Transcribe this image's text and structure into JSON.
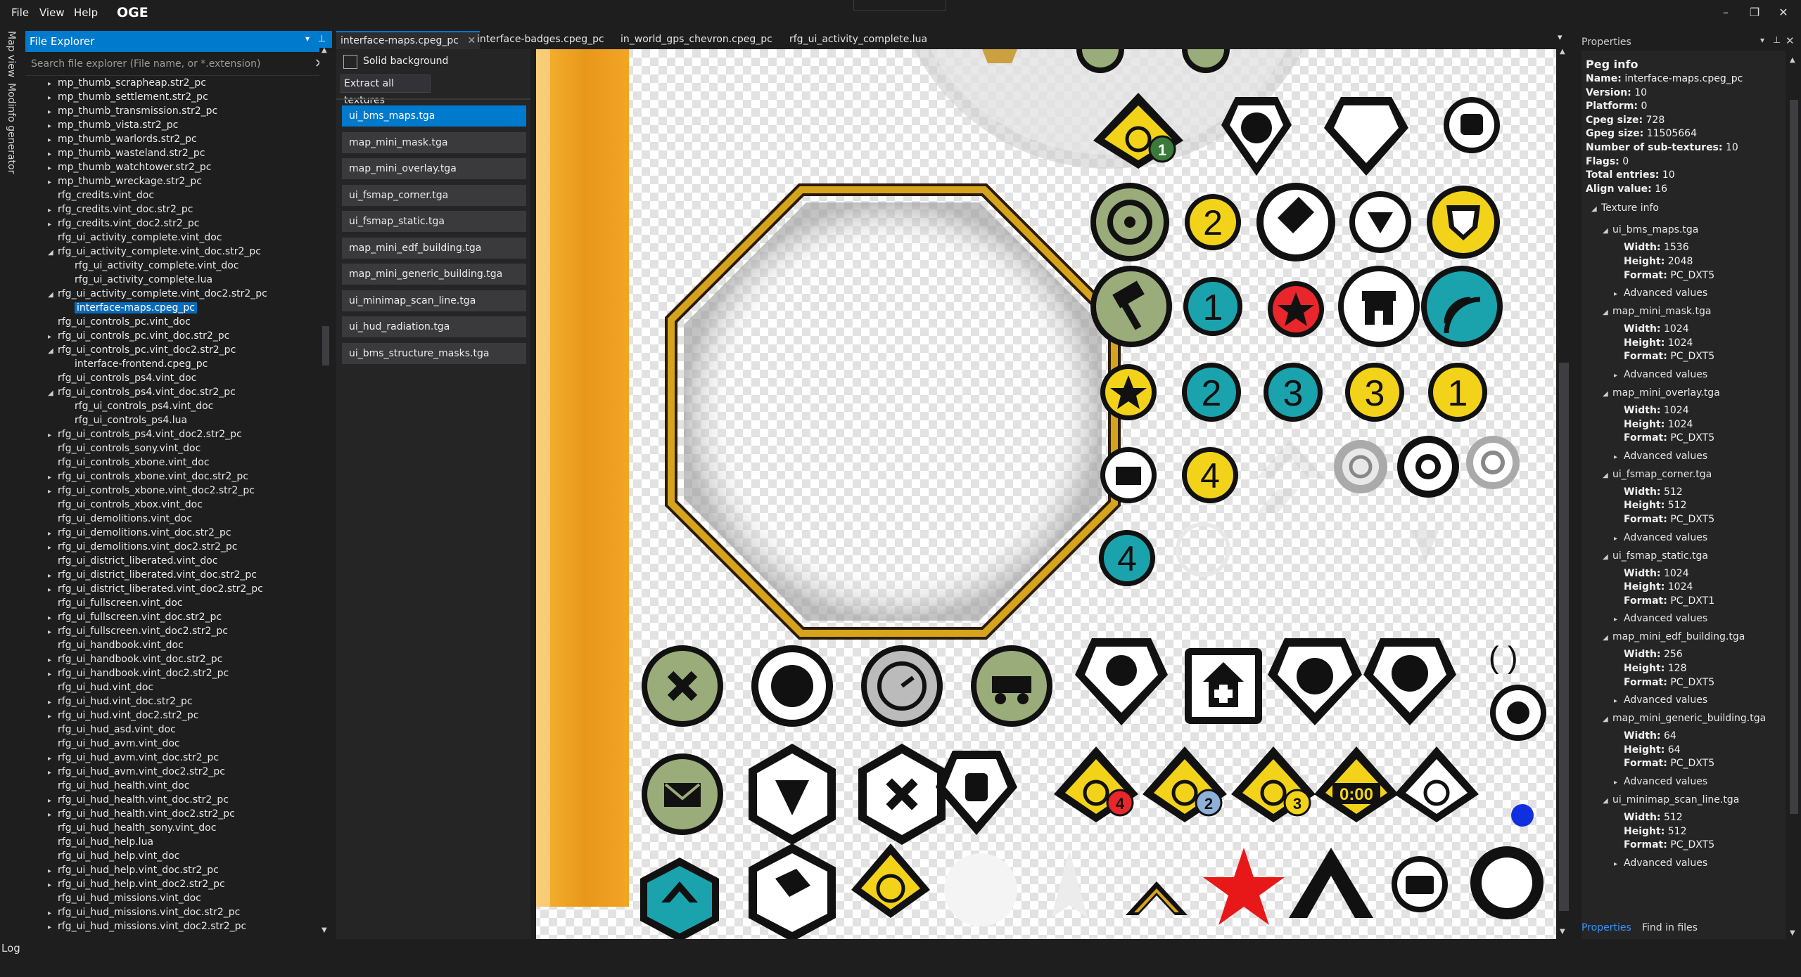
{
  "app": {
    "title": "OGE"
  },
  "menu": {
    "items": [
      "File",
      "View",
      "Help"
    ]
  },
  "window_controls": {
    "minimize": "–",
    "restore": "❐",
    "close": "✕"
  },
  "side_tabs": [
    "Map view",
    "Modinfo generator"
  ],
  "explorer": {
    "title": "File Explorer",
    "search_placeholder": "Search file explorer (File name, or *.extension)",
    "items": [
      {
        "label": "mp_thumb_scrapheap.str2_pc",
        "level": 1,
        "arrow": "▸"
      },
      {
        "label": "mp_thumb_settlement.str2_pc",
        "level": 1,
        "arrow": "▸"
      },
      {
        "label": "mp_thumb_transmission.str2_pc",
        "level": 1,
        "arrow": "▸"
      },
      {
        "label": "mp_thumb_vista.str2_pc",
        "level": 1,
        "arrow": "▸"
      },
      {
        "label": "mp_thumb_warlords.str2_pc",
        "level": 1,
        "arrow": "▸"
      },
      {
        "label": "mp_thumb_wasteland.str2_pc",
        "level": 1,
        "arrow": "▸"
      },
      {
        "label": "mp_thumb_watchtower.str2_pc",
        "level": 1,
        "arrow": "▸"
      },
      {
        "label": "mp_thumb_wreckage.str2_pc",
        "level": 1,
        "arrow": "▸"
      },
      {
        "label": "rfg_credits.vint_doc",
        "level": 1,
        "arrow": ""
      },
      {
        "label": "rfg_credits.vint_doc.str2_pc",
        "level": 1,
        "arrow": "▸"
      },
      {
        "label": "rfg_credits.vint_doc2.str2_pc",
        "level": 1,
        "arrow": "▸"
      },
      {
        "label": "rfg_ui_activity_complete.vint_doc",
        "level": 1,
        "arrow": ""
      },
      {
        "label": "rfg_ui_activity_complete.vint_doc.str2_pc",
        "level": 1,
        "arrow": "◢"
      },
      {
        "label": "rfg_ui_activity_complete.vint_doc",
        "level": 2,
        "arrow": ""
      },
      {
        "label": "rfg_ui_activity_complete.lua",
        "level": 2,
        "arrow": ""
      },
      {
        "label": "rfg_ui_activity_complete.vint_doc2.str2_pc",
        "level": 1,
        "arrow": "◢"
      },
      {
        "label": "interface-maps.cpeg_pc",
        "level": 2,
        "arrow": "",
        "selected": true
      },
      {
        "label": "rfg_ui_controls_pc.vint_doc",
        "level": 1,
        "arrow": ""
      },
      {
        "label": "rfg_ui_controls_pc.vint_doc.str2_pc",
        "level": 1,
        "arrow": "▸"
      },
      {
        "label": "rfg_ui_controls_pc.vint_doc2.str2_pc",
        "level": 1,
        "arrow": "◢"
      },
      {
        "label": "interface-frontend.cpeg_pc",
        "level": 2,
        "arrow": ""
      },
      {
        "label": "rfg_ui_controls_ps4.vint_doc",
        "level": 1,
        "arrow": ""
      },
      {
        "label": "rfg_ui_controls_ps4.vint_doc.str2_pc",
        "level": 1,
        "arrow": "◢"
      },
      {
        "label": "rfg_ui_controls_ps4.vint_doc",
        "level": 2,
        "arrow": ""
      },
      {
        "label": "rfg_ui_controls_ps4.lua",
        "level": 2,
        "arrow": ""
      },
      {
        "label": "rfg_ui_controls_ps4.vint_doc2.str2_pc",
        "level": 1,
        "arrow": "▸"
      },
      {
        "label": "rfg_ui_controls_sony.vint_doc",
        "level": 1,
        "arrow": ""
      },
      {
        "label": "rfg_ui_controls_xbone.vint_doc",
        "level": 1,
        "arrow": ""
      },
      {
        "label": "rfg_ui_controls_xbone.vint_doc.str2_pc",
        "level": 1,
        "arrow": "▸"
      },
      {
        "label": "rfg_ui_controls_xbone.vint_doc2.str2_pc",
        "level": 1,
        "arrow": "▸"
      },
      {
        "label": "rfg_ui_controls_xbox.vint_doc",
        "level": 1,
        "arrow": ""
      },
      {
        "label": "rfg_ui_demolitions.vint_doc",
        "level": 1,
        "arrow": ""
      },
      {
        "label": "rfg_ui_demolitions.vint_doc.str2_pc",
        "level": 1,
        "arrow": "▸"
      },
      {
        "label": "rfg_ui_demolitions.vint_doc2.str2_pc",
        "level": 1,
        "arrow": "▸"
      },
      {
        "label": "rfg_ui_district_liberated.vint_doc",
        "level": 1,
        "arrow": ""
      },
      {
        "label": "rfg_ui_district_liberated.vint_doc.str2_pc",
        "level": 1,
        "arrow": "▸"
      },
      {
        "label": "rfg_ui_district_liberated.vint_doc2.str2_pc",
        "level": 1,
        "arrow": "▸"
      },
      {
        "label": "rfg_ui_fullscreen.vint_doc",
        "level": 1,
        "arrow": ""
      },
      {
        "label": "rfg_ui_fullscreen.vint_doc.str2_pc",
        "level": 1,
        "arrow": "▸"
      },
      {
        "label": "rfg_ui_fullscreen.vint_doc2.str2_pc",
        "level": 1,
        "arrow": "▸"
      },
      {
        "label": "rfg_ui_handbook.vint_doc",
        "level": 1,
        "arrow": ""
      },
      {
        "label": "rfg_ui_handbook.vint_doc.str2_pc",
        "level": 1,
        "arrow": "▸"
      },
      {
        "label": "rfg_ui_handbook.vint_doc2.str2_pc",
        "level": 1,
        "arrow": "▸"
      },
      {
        "label": "rfg_ui_hud.vint_doc",
        "level": 1,
        "arrow": ""
      },
      {
        "label": "rfg_ui_hud.vint_doc.str2_pc",
        "level": 1,
        "arrow": "▸"
      },
      {
        "label": "rfg_ui_hud.vint_doc2.str2_pc",
        "level": 1,
        "arrow": "▸"
      },
      {
        "label": "rfg_ui_hud_asd.vint_doc",
        "level": 1,
        "arrow": ""
      },
      {
        "label": "rfg_ui_hud_avm.vint_doc",
        "level": 1,
        "arrow": ""
      },
      {
        "label": "rfg_ui_hud_avm.vint_doc.str2_pc",
        "level": 1,
        "arrow": "▸"
      },
      {
        "label": "rfg_ui_hud_avm.vint_doc2.str2_pc",
        "level": 1,
        "arrow": "▸"
      },
      {
        "label": "rfg_ui_hud_health.vint_doc",
        "level": 1,
        "arrow": ""
      },
      {
        "label": "rfg_ui_hud_health.vint_doc.str2_pc",
        "level": 1,
        "arrow": "▸"
      },
      {
        "label": "rfg_ui_hud_health.vint_doc2.str2_pc",
        "level": 1,
        "arrow": "▸"
      },
      {
        "label": "rfg_ui_hud_health_sony.vint_doc",
        "level": 1,
        "arrow": ""
      },
      {
        "label": "rfg_ui_hud_help.lua",
        "level": 1,
        "arrow": ""
      },
      {
        "label": "rfg_ui_hud_help.vint_doc",
        "level": 1,
        "arrow": ""
      },
      {
        "label": "rfg_ui_hud_help.vint_doc.str2_pc",
        "level": 1,
        "arrow": "▸"
      },
      {
        "label": "rfg_ui_hud_help.vint_doc2.str2_pc",
        "level": 1,
        "arrow": "▸"
      },
      {
        "label": "rfg_ui_hud_missions.vint_doc",
        "level": 1,
        "arrow": ""
      },
      {
        "label": "rfg_ui_hud_missions.vint_doc.str2_pc",
        "level": 1,
        "arrow": "▸"
      },
      {
        "label": "rfg_ui_hud_missions.vint_doc2.str2_pc",
        "level": 1,
        "arrow": "▸"
      }
    ]
  },
  "tabs": [
    {
      "label": "interface-maps.cpeg_pc",
      "active": true,
      "close": "✕"
    },
    {
      "label": "interface-badges.cpeg_pc"
    },
    {
      "label": "in_world_gps_chevron.cpeg_pc"
    },
    {
      "label": "rfg_ui_activity_complete.lua"
    }
  ],
  "texture_panel": {
    "solid_background_label": "Solid background",
    "extract_all_label": "Extract all textures",
    "textures": [
      {
        "name": "ui_bms_maps.tga",
        "selected": true
      },
      {
        "name": "map_mini_mask.tga"
      },
      {
        "name": "map_mini_overlay.tga"
      },
      {
        "name": "ui_fsmap_corner.tga"
      },
      {
        "name": "ui_fsmap_static.tga"
      },
      {
        "name": "map_mini_edf_building.tga"
      },
      {
        "name": "map_mini_generic_building.tga"
      },
      {
        "name": "ui_minimap_scan_line.tga"
      },
      {
        "name": "ui_hud_radiation.tga"
      },
      {
        "name": "ui_bms_structure_masks.tga"
      }
    ]
  },
  "preview": {
    "badge_numbers": {
      "n1": "1",
      "n2": "2",
      "n3": "3",
      "n4": "4"
    },
    "timer_text": "0:00",
    "colors": {
      "accent": "#007acc",
      "yellow": "#f2d31a",
      "teal": "#1aa3ad",
      "olive": "#9aac7a",
      "red": "#e8262b",
      "blue": "#1030e0",
      "orange": "#e8971a"
    }
  },
  "properties": {
    "title": "Properties",
    "peg_info_heading": "Peg info",
    "peg_info": [
      {
        "key": "Name:",
        "value": "interface-maps.cpeg_pc"
      },
      {
        "key": "Version:",
        "value": "10"
      },
      {
        "key": "Platform:",
        "value": "0"
      },
      {
        "key": "Cpeg size:",
        "value": "728"
      },
      {
        "key": "Gpeg size:",
        "value": "11505664"
      },
      {
        "key": "Number of sub-textures:",
        "value": "10"
      },
      {
        "key": "Flags:",
        "value": "0"
      },
      {
        "key": "Total entries:",
        "value": "10"
      },
      {
        "key": "Align value:",
        "value": "16"
      }
    ],
    "texture_info_heading": "Texture info",
    "advanced_label": "Advanced values",
    "textures": [
      {
        "name": "ui_bms_maps.tga",
        "width": "1536",
        "height": "2048",
        "format": "PC_DXT5"
      },
      {
        "name": "map_mini_mask.tga",
        "width": "1024",
        "height": "1024",
        "format": "PC_DXT5"
      },
      {
        "name": "map_mini_overlay.tga",
        "width": "1024",
        "height": "1024",
        "format": "PC_DXT5"
      },
      {
        "name": "ui_fsmap_corner.tga",
        "width": "512",
        "height": "512",
        "format": "PC_DXT5"
      },
      {
        "name": "ui_fsmap_static.tga",
        "width": "1024",
        "height": "1024",
        "format": "PC_DXT1"
      },
      {
        "name": "map_mini_edf_building.tga",
        "width": "256",
        "height": "128",
        "format": "PC_DXT5"
      },
      {
        "name": "map_mini_generic_building.tga",
        "width": "64",
        "height": "64",
        "format": "PC_DXT5"
      },
      {
        "name": "ui_minimap_scan_line.tga",
        "width": "512",
        "height": "512",
        "format": "PC_DXT5"
      }
    ],
    "field_labels": {
      "width": "Width:",
      "height": "Height:",
      "format": "Format:"
    },
    "bottom_tabs": [
      "Properties",
      "Find in files"
    ]
  },
  "log": {
    "label": "Log"
  }
}
